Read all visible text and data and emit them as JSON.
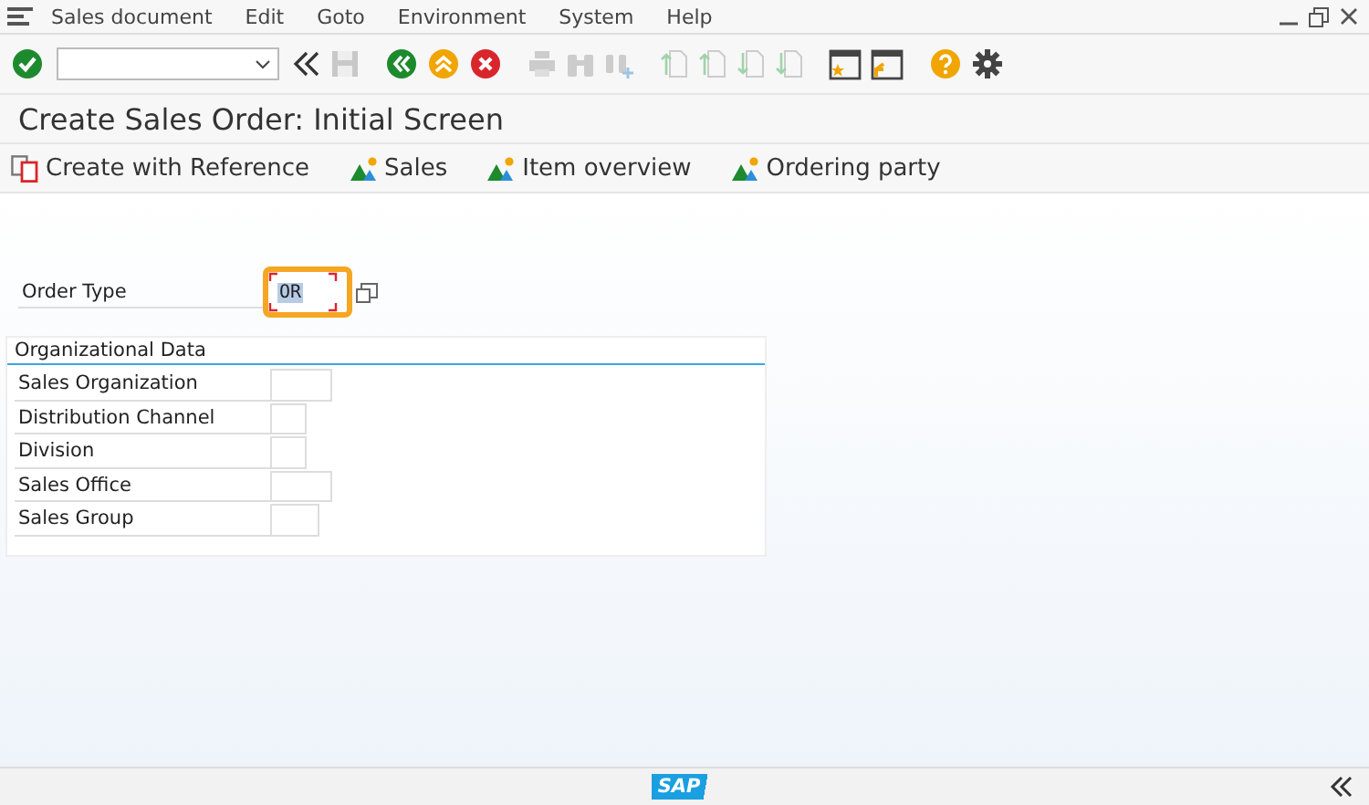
{
  "menu": [
    "Sales document",
    "Edit",
    "Goto",
    "Environment",
    "System",
    "Help"
  ],
  "title": "Create Sales Order: Initial Screen",
  "app_toolbar": [
    {
      "kind": "copy",
      "label": "Create with Reference"
    },
    {
      "kind": "jump",
      "label": "Sales"
    },
    {
      "kind": "jump",
      "label": "Item overview"
    },
    {
      "kind": "jump",
      "label": "Ordering party"
    }
  ],
  "order_type": {
    "label": "Order Type",
    "value": "OR",
    "focused": true
  },
  "org_data": {
    "title": "Organizational Data",
    "fields": [
      {
        "label": "Sales Organization"
      },
      {
        "label": "Distribution Channel"
      },
      {
        "label": "Division"
      },
      {
        "label": "Sales Office"
      },
      {
        "label": "Sales Group"
      }
    ]
  },
  "footer": {
    "logo": "SAP"
  }
}
